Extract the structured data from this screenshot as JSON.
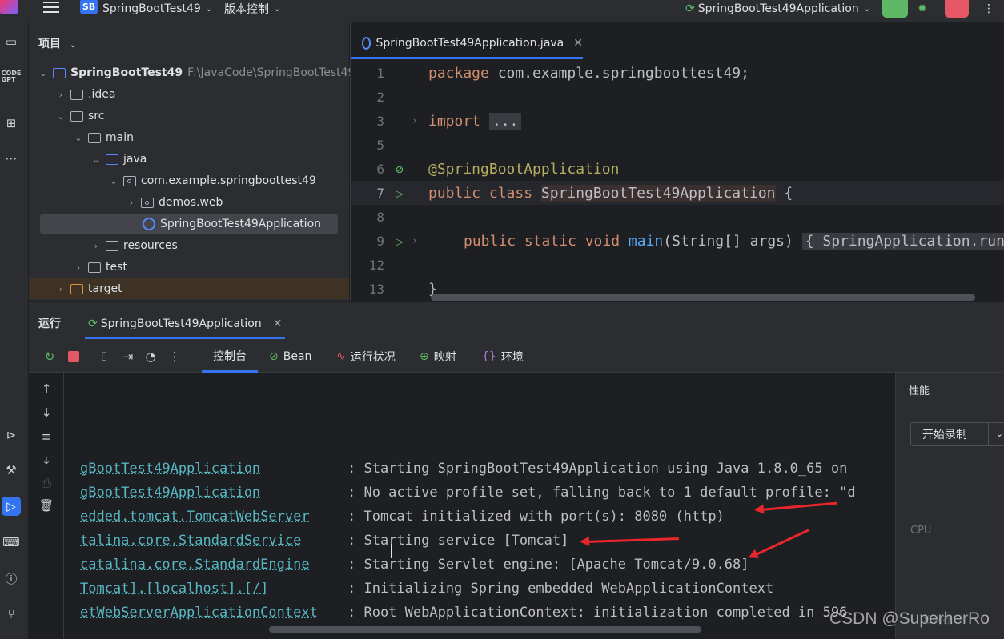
{
  "titlebar": {
    "project_name": "SpringBootTest49",
    "project_badge": "SB",
    "vcs_menu": "版本控制",
    "run_config": "SpringBootTest49Application",
    "more": "⋮"
  },
  "project_panel": {
    "title": "项目",
    "tree": [
      {
        "label": "SpringBootTest49",
        "path": "F:\\JavaCode\\SpringBootTest49"
      },
      {
        "label": ".idea"
      },
      {
        "label": "src"
      },
      {
        "label": "main"
      },
      {
        "label": "java"
      },
      {
        "label": "com.example.springboottest49"
      },
      {
        "label": "demos.web"
      },
      {
        "label": "SpringBootTest49Application"
      },
      {
        "label": "resources"
      },
      {
        "label": "test"
      },
      {
        "label": "target"
      }
    ]
  },
  "editor": {
    "tab_label": "SpringBootTest49Application.java",
    "lines": [
      {
        "num": "1",
        "code_kw": "package",
        "code_rest": " com.example.springboottest49;"
      },
      {
        "num": "2"
      },
      {
        "num": "3",
        "code_kw": "import",
        "code_rest": "..."
      },
      {
        "num": "5"
      },
      {
        "num": "6",
        "code_ann": "@SpringBootApplication"
      },
      {
        "num": "7",
        "code_kw": "public class",
        "code_cls": "SpringBootTest49Application",
        "code_rest": " {"
      },
      {
        "num": "8"
      },
      {
        "num": "9",
        "code_kw": "public static void",
        "code_fn": "main",
        "code_rest": "(String[] args)",
        "code_tail": "{ SpringApplication.run"
      },
      {
        "num": "12"
      },
      {
        "num": "13",
        "code_rest": "}"
      }
    ]
  },
  "run_panel": {
    "title": "运行",
    "tab_label": "SpringBootTest49Application",
    "console_tabs": [
      "控制台",
      "Bean",
      "运行状况",
      "映射",
      "环境"
    ],
    "log": [
      {
        "cls": "gBootTest49Application",
        "msg": ": Starting SpringBootTest49Application using Java 1.8.0_65 on"
      },
      {
        "cls": "gBootTest49Application",
        "msg": ": No active profile set, falling back to 1 default profile: \"d"
      },
      {
        "cls": "edded.tomcat.TomcatWebServer",
        "msg": ": Tomcat initialized with port(s): 8080 (http)"
      },
      {
        "cls": "talina.core.StandardService",
        "msg": ": Starting service [Tomcat]"
      },
      {
        "cls": "catalina.core.StandardEngine",
        "msg": ": Starting Servlet engine: [Apache Tomcat/9.0.68]"
      },
      {
        "cls": "Tomcat].[localhost].[/]",
        "msg": ": Initializing Spring embedded WebApplicationContext"
      },
      {
        "cls": "etWebServerApplicationContext",
        "msg": ": Root WebApplicationContext: initialization completed in 596"
      }
    ],
    "perf": {
      "title": "性能",
      "record_button": "开始录制",
      "cpu_label": "CPU",
      "mem_label": "堆内存"
    }
  },
  "watermark": "CSDN @SuperherRo",
  "colors": {
    "accent": "#3574f0",
    "run_green": "#5fb865",
    "stop_red": "#e55765",
    "annotation_arrow": "#e8262b"
  }
}
